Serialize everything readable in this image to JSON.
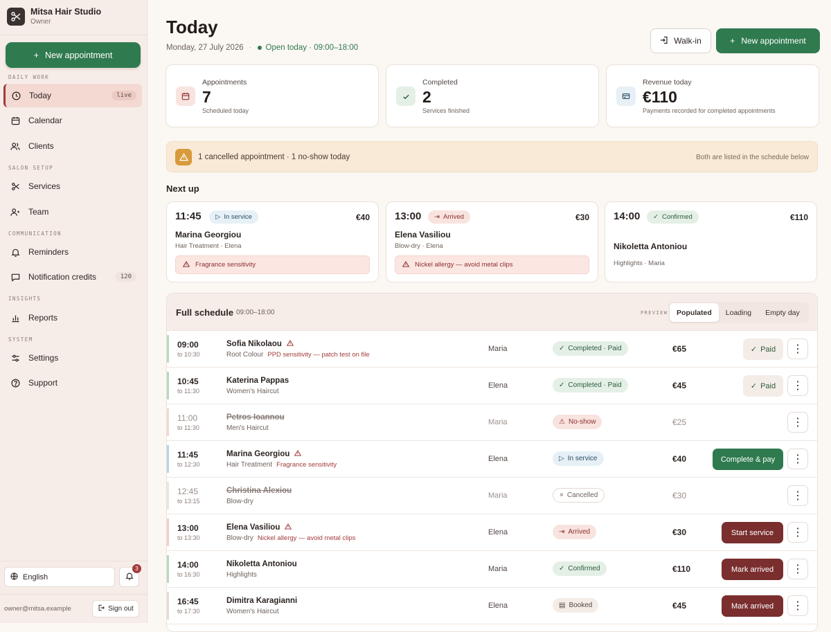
{
  "brand": {
    "name": "Mitsa Hair Studio",
    "role": "Owner"
  },
  "sidebar": {
    "new_button": "New appointment",
    "sections": {
      "daily": "DAILY WORK",
      "setup": "SALON SETUP",
      "comm": "COMMUNICATION",
      "insights": "INSIGHTS",
      "system": "SYSTEM"
    },
    "items": [
      {
        "label": "Today",
        "badge": "live"
      },
      {
        "label": "Calendar"
      },
      {
        "label": "Clients"
      },
      {
        "label": "Services"
      },
      {
        "label": "Team"
      },
      {
        "label": "Reminders"
      },
      {
        "label": "Notification credits",
        "badge": "120"
      },
      {
        "label": "Reports"
      },
      {
        "label": "Settings"
      },
      {
        "label": "Support"
      }
    ],
    "language": "English",
    "notifications": "3",
    "email": "owner@mitsa.example",
    "signout": "Sign out"
  },
  "header": {
    "title": "Today",
    "date": "Monday, 27 July 2026",
    "separator": "·",
    "open_status": "Open today · 09:00–18:00",
    "walkin": "Walk-in",
    "new_appt": "New appointment"
  },
  "stats": [
    {
      "label": "Appointments",
      "value": "7",
      "sub": "Scheduled today"
    },
    {
      "label": "Completed",
      "value": "2",
      "sub": "Services finished"
    },
    {
      "label": "Revenue today",
      "value": "€110",
      "sub": "Payments recorded for completed appointments"
    }
  ],
  "alert": {
    "text": "1 cancelled appointment · 1 no-show today",
    "note": "Both are listed in the schedule below"
  },
  "next_up": {
    "title": "Next up",
    "cards": [
      {
        "time": "11:45",
        "status": "In service",
        "price": "€40",
        "client": "Marina Georgiou",
        "service": "Hair Treatment · Elena",
        "alert": "Fragrance sensitivity"
      },
      {
        "time": "13:00",
        "status": "Arrived",
        "price": "€30",
        "client": "Elena Vasiliou",
        "service": "Blow-dry · Elena",
        "alert": "Nickel allergy — avoid metal clips"
      },
      {
        "time": "14:00",
        "status": "Confirmed",
        "price": "€110",
        "client": "Nikoletta Antoniou",
        "service": "Highlights · Maria"
      }
    ]
  },
  "schedule": {
    "title": "Full schedule",
    "hours": "09:00–18:00",
    "preview_label": "PREVIEW",
    "tabs": [
      "Populated",
      "Loading",
      "Empty day"
    ],
    "rows": [
      {
        "time": "09:00",
        "to": "to 10:30",
        "client": "Sofia Nikolaou",
        "service": "Root Colour",
        "note": "PPD sensitivity — patch test on file",
        "staff": "Maria",
        "status": "Completed · Paid",
        "price": "€65",
        "action": "Paid"
      },
      {
        "time": "10:45",
        "to": "to 11:30",
        "client": "Katerina Pappas",
        "service": "Women's Haircut",
        "note": "",
        "staff": "Elena",
        "status": "Completed · Paid",
        "price": "€45",
        "action": "Paid"
      },
      {
        "time": "11:00",
        "to": "to 11:30",
        "client": "Petros Ioannou",
        "service": "Men's Haircut",
        "note": "",
        "staff": "Maria",
        "status": "No-show",
        "price": "€25",
        "action": ""
      },
      {
        "time": "11:45",
        "to": "to 12:30",
        "client": "Marina Georgiou",
        "service": "Hair Treatment",
        "note": "Fragrance sensitivity",
        "staff": "Elena",
        "status": "In service",
        "price": "€40",
        "action": "Complete & pay"
      },
      {
        "time": "12:45",
        "to": "to 13:15",
        "client": "Christina Alexiou",
        "service": "Blow-dry",
        "note": "",
        "staff": "Maria",
        "status": "Cancelled",
        "price": "€30",
        "action": ""
      },
      {
        "time": "13:00",
        "to": "to 13:30",
        "client": "Elena Vasiliou",
        "service": "Blow-dry",
        "note": "Nickel allergy — avoid metal clips",
        "staff": "Elena",
        "status": "Arrived",
        "price": "€30",
        "action": "Start service"
      },
      {
        "time": "14:00",
        "to": "to 16:30",
        "client": "Nikoletta Antoniou",
        "service": "Highlights",
        "note": "",
        "staff": "Maria",
        "status": "Confirmed",
        "price": "€110",
        "action": "Mark arrived"
      },
      {
        "time": "16:45",
        "to": "to 17:30",
        "client": "Dimitra Karagianni",
        "service": "Women's Haircut",
        "note": "",
        "staff": "Elena",
        "status": "Booked",
        "price": "€45",
        "action": "Mark arrived"
      }
    ]
  },
  "colors": {
    "accent": "#2f7a4f",
    "danger": "#7a2e2e",
    "warning": "#d99a3b",
    "active_nav": "#f4d9d3"
  }
}
